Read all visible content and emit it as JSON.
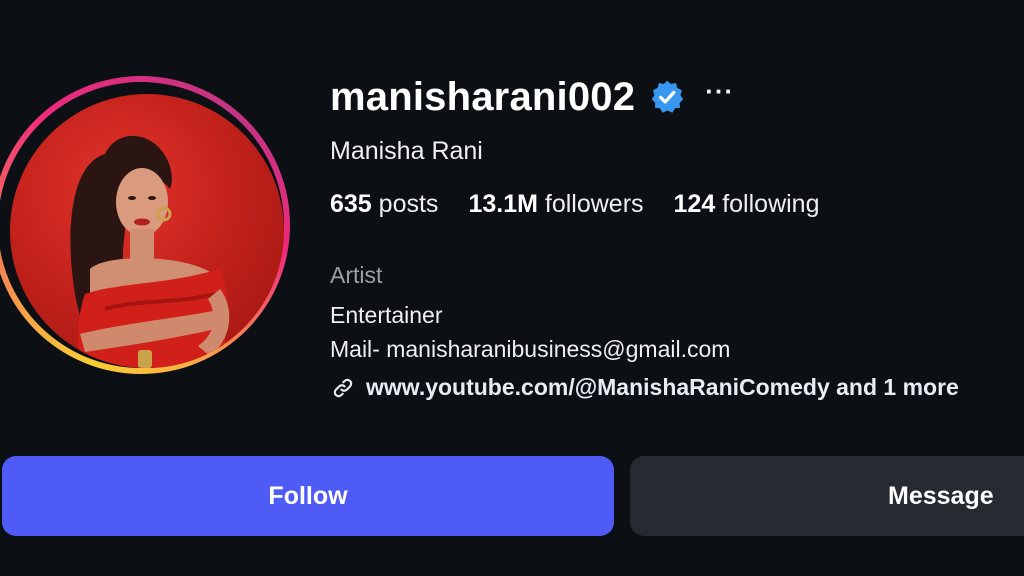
{
  "profile": {
    "username": "manisharani002",
    "full_name": "Manisha Rani",
    "more_label": "···",
    "stats": {
      "posts_count": "635",
      "posts_label": "posts",
      "followers_count": "13.1M",
      "followers_label": "followers",
      "following_count": "124",
      "following_label": "following"
    },
    "category": "Artist",
    "bio_lines": [
      "Entertainer",
      "Mail- manisharanibusiness@gmail.com"
    ],
    "link_text": "www.youtube.com/@ManishaRaniComedy and 1 more"
  },
  "actions": {
    "follow_label": "Follow",
    "message_label": "Message"
  },
  "icons": {
    "verified": "verified-badge-icon",
    "more": "more-options-icon",
    "link": "link-icon"
  },
  "colors": {
    "background": "#0c0f14",
    "follow_button": "#4f5bf5",
    "message_button": "#262a31",
    "verified_badge": "#3897f0",
    "muted_text": "#9aa0a6"
  }
}
